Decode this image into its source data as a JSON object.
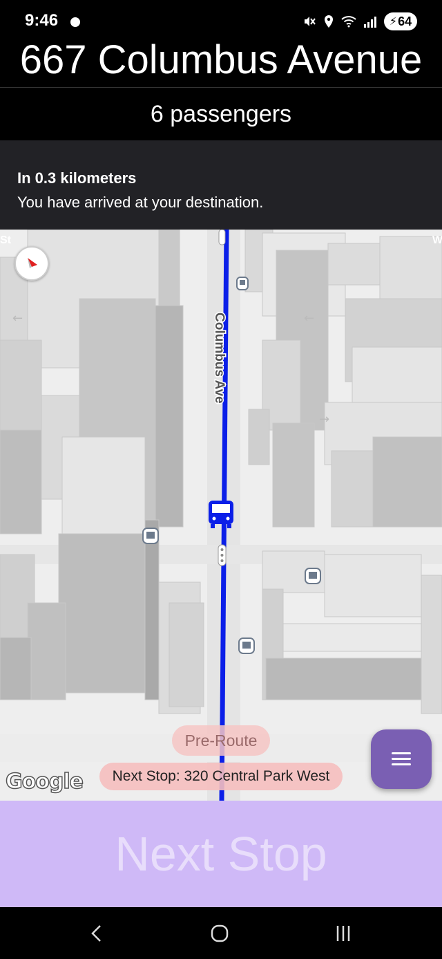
{
  "status_bar": {
    "time": "9:46",
    "battery": "64"
  },
  "header": {
    "address": "667 Columbus Avenue",
    "passengers": "6 passengers"
  },
  "navigation": {
    "distance": "In 0.3 kilometers",
    "instruction": "You have arrived at your destination."
  },
  "map": {
    "street_label": "Columbus Ave",
    "edge_label_left": "St",
    "edge_label_right": "W",
    "route_color": "#0b1fe8",
    "logo": "Google"
  },
  "overlays": {
    "pre_route": "Pre-Route",
    "next_stop_info": "Next Stop: 320 Central Park West"
  },
  "actions": {
    "next_stop": "Next Stop"
  },
  "icons": {
    "menu": "hamburger-menu-icon",
    "compass": "compass-icon",
    "bus": "bus-icon",
    "transit_stop": "transit-stop-icon"
  }
}
